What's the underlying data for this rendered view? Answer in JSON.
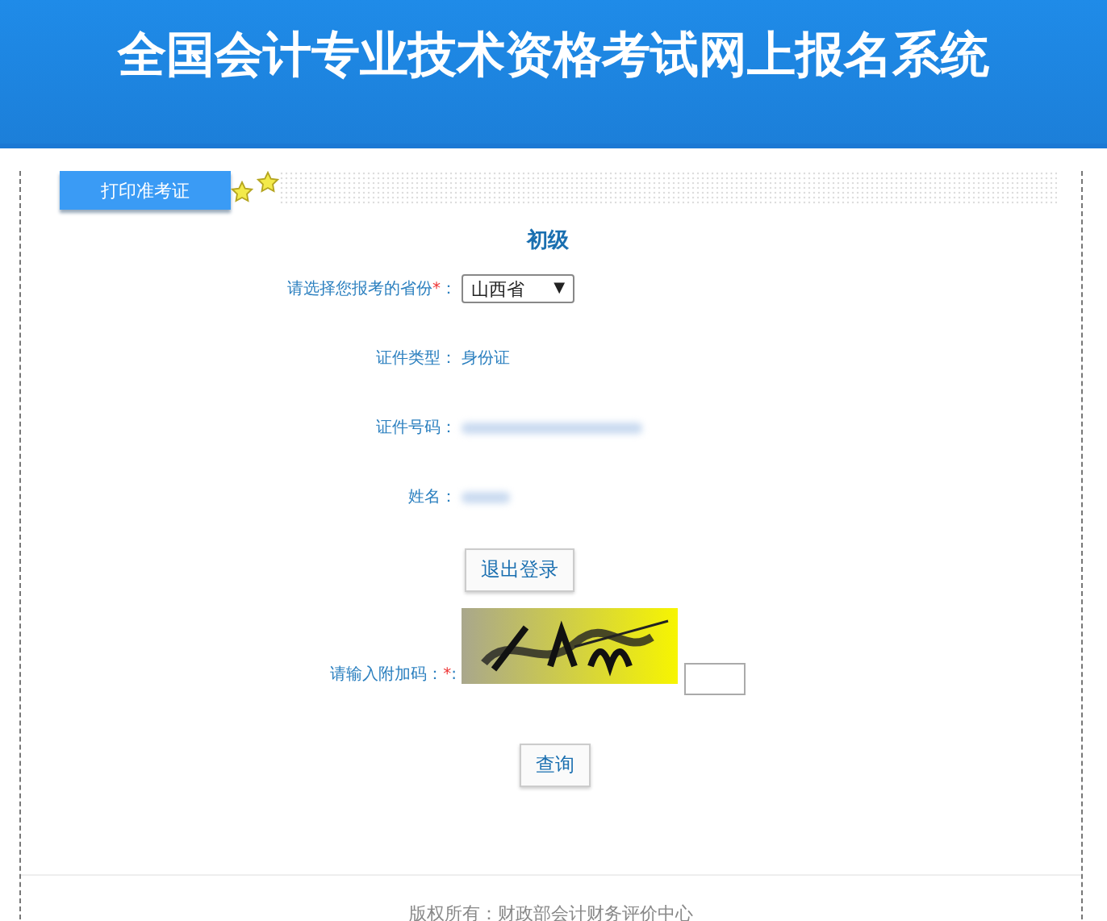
{
  "header": {
    "title": "全国会计专业技术资格考试网上报名系统"
  },
  "tab": {
    "label": "打印准考证",
    "selected": true
  },
  "level_title": "初级",
  "fields": [
    {
      "kind": "select",
      "label": "请选择您报考的省份",
      "required_mark": "*",
      "colon": "：",
      "value": "山西省",
      "arrow": "▼"
    },
    {
      "kind": "text",
      "label": "证件类型：",
      "value": "身份证"
    },
    {
      "kind": "blurred",
      "label": "证件号码："
    },
    {
      "kind": "blurred",
      "label": "姓名："
    }
  ],
  "logout_button": "退出登录",
  "captcha": {
    "label": "请输入附加码：",
    "required_mark": "*",
    "colon": ":"
  },
  "query_button": "查询",
  "footer": "版权所有：财政部会计财务评价中心"
}
